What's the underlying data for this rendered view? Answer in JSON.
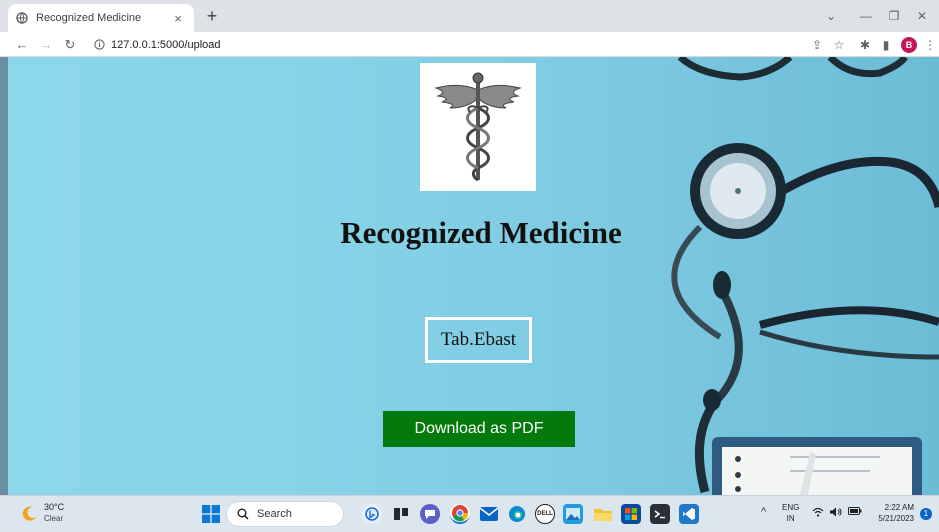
{
  "browser": {
    "tab_title": "Recognized Medicine",
    "tab_close": "×",
    "new_tab": "+",
    "url": "127.0.0.1:5000/upload",
    "profile_initial": "B",
    "controls": {
      "minimize": "—",
      "restore": "❐",
      "close": "✕",
      "tab_search": "⌄"
    }
  },
  "page": {
    "title": "Recognized Medicine",
    "medicine_name": "Tab.Ebast",
    "download_button": "Download as PDF",
    "logo": "caduceus-logo"
  },
  "taskbar": {
    "weather_temp": "30°C",
    "weather_condition": "Clear",
    "search_label": "Search",
    "lang_line1": "ENG",
    "lang_line2": "IN",
    "time": "2:22 AM",
    "date": "5/21/2023",
    "notification_count": "1"
  },
  "colors": {
    "download_button": "#047a0c",
    "page_background": "#86d3e8",
    "profile_avatar": "#c2185b"
  }
}
